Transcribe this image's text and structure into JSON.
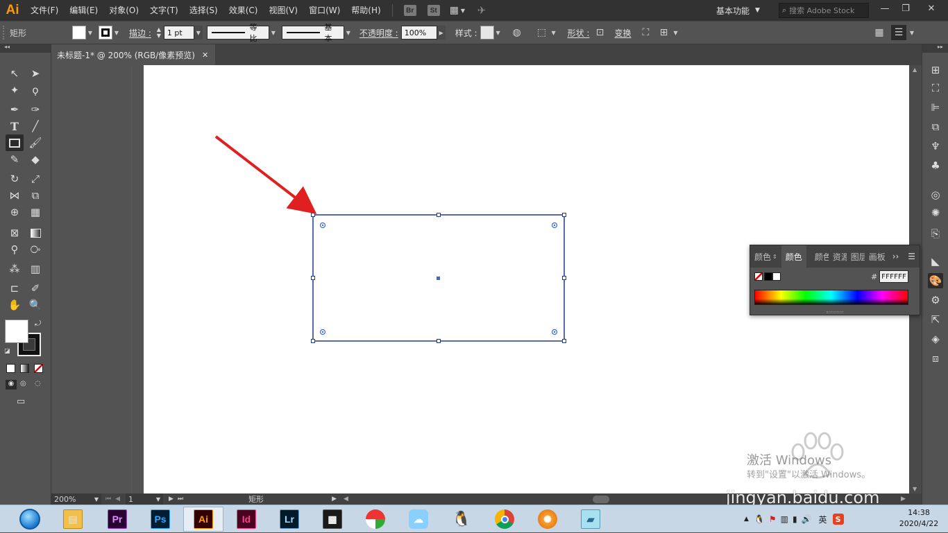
{
  "app": {
    "logo": "Ai"
  },
  "menu": [
    "文件(F)",
    "编辑(E)",
    "对象(O)",
    "文字(T)",
    "选择(S)",
    "效果(C)",
    "视图(V)",
    "窗口(W)",
    "帮助(H)"
  ],
  "menubar_badges": {
    "bridge": "Br",
    "stock": "St"
  },
  "workspace": {
    "label": "基本功能"
  },
  "search": {
    "placeholder": "搜索 Adobe Stock"
  },
  "window_controls": {
    "minimize": "—",
    "restore": "❐",
    "close": "✕"
  },
  "controlbar": {
    "object_type": "矩形",
    "stroke_label": "描边 :",
    "stroke_weight": "1 pt",
    "stroke_profile": "等比",
    "brush_profile": "基本",
    "opacity_label": "不透明度 :",
    "opacity_value": "100%",
    "style_label": "样式 :",
    "shape_label": "形状 :",
    "transform_label": "变换"
  },
  "document": {
    "tab_title": "未标题-1* @ 200% (RGB/像素预览)",
    "close_glyph": "✕"
  },
  "statusbar": {
    "zoom": "200%",
    "artboard_number": "1",
    "current_tool": "矩形"
  },
  "color_panel": {
    "tabs": [
      "颜色",
      "颜色",
      "颜色",
      "资源",
      "图层",
      "画板"
    ],
    "active_tab": 1,
    "hex_value": "FFFFFF",
    "hash": "#",
    "more": "››"
  },
  "taskbar": {
    "apps": [
      "Pr",
      "Ps",
      "Ai",
      "Id",
      "Lr"
    ],
    "active_app": "Ai",
    "ime": "英",
    "time": "14:38",
    "date": "2020/4/22"
  },
  "watermark": {
    "activate": "激活 Windows",
    "sub": "转到\"设置\"以激活 Windows。",
    "site": "jingyan.baidu.com"
  },
  "colors": {
    "accent": "#ff9a00",
    "selection": "#1a3a8f",
    "guide": "#cc2a2a",
    "arrow": "#e02020"
  }
}
